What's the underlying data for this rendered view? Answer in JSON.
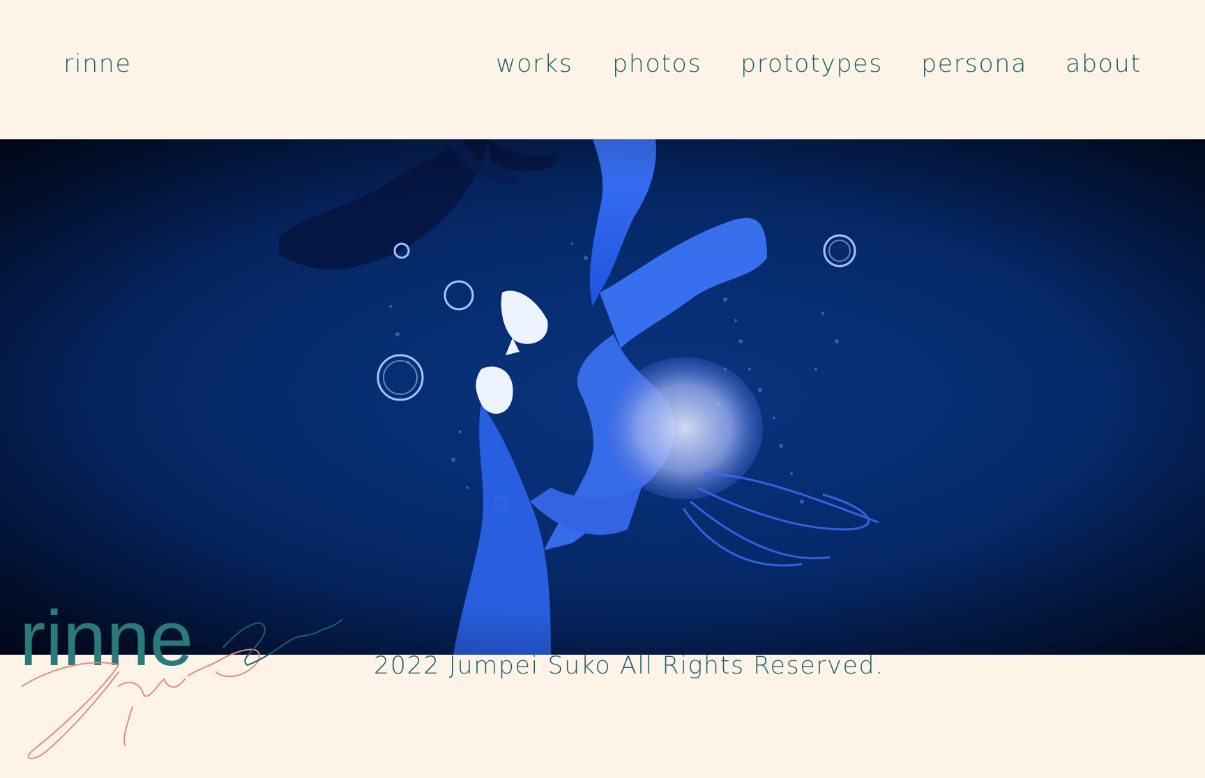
{
  "header": {
    "brand": "rinne",
    "nav": [
      "works",
      "photos",
      "prototypes",
      "persona",
      "about"
    ]
  },
  "hero": {
    "image": "underwater-illustration"
  },
  "footer": {
    "copyright": "2022 Jumpei Suko All Rights Reserved."
  },
  "logo": {
    "word": "rinne",
    "signature": "Jumpei Suko"
  },
  "colors": {
    "background": "#fdf4e7",
    "text": "#1f5e6b",
    "logo_teal": "#2b7a7a",
    "logo_pink": "#e58a80",
    "hero_blue": "#062a6b"
  }
}
